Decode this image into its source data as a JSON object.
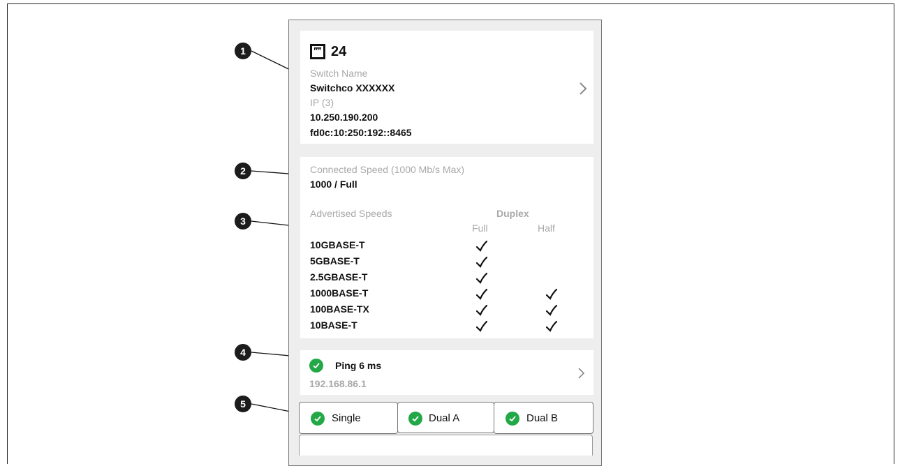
{
  "port": {
    "icon": "ethernet-port-icon",
    "number": "24"
  },
  "switch": {
    "name_label": "Switch Name",
    "name_value": "Switchco XXXXXX",
    "ip_label": "IP (3)",
    "ipv4": "10.250.190.200",
    "ipv6": "fd0c:10:250:192::8465"
  },
  "speed": {
    "connected_label": "Connected Speed (1000 Mb/s Max)",
    "connected_value": "1000 / Full",
    "advertised_label": "Advertised Speeds",
    "duplex_label": "Duplex",
    "full_label": "Full",
    "half_label": "Half",
    "rows": [
      {
        "name": "10GBASE-T",
        "full": true,
        "half": false
      },
      {
        "name": "5GBASE-T",
        "full": true,
        "half": false
      },
      {
        "name": "2.5GBASE-T",
        "full": true,
        "half": false
      },
      {
        "name": "1000BASE-T",
        "full": true,
        "half": true
      },
      {
        "name": "100BASE-TX",
        "full": true,
        "half": true
      },
      {
        "name": "10BASE-T",
        "full": true,
        "half": true
      }
    ]
  },
  "ping": {
    "label": "Ping 6 ms",
    "address": "192.168.86.1",
    "status_color": "#23a847"
  },
  "tabs": [
    {
      "label": "Single",
      "status": "ok"
    },
    {
      "label": "Dual A",
      "status": "ok"
    },
    {
      "label": "Dual B",
      "status": "ok"
    }
  ],
  "callouts": [
    "1",
    "2",
    "3",
    "4",
    "5"
  ]
}
